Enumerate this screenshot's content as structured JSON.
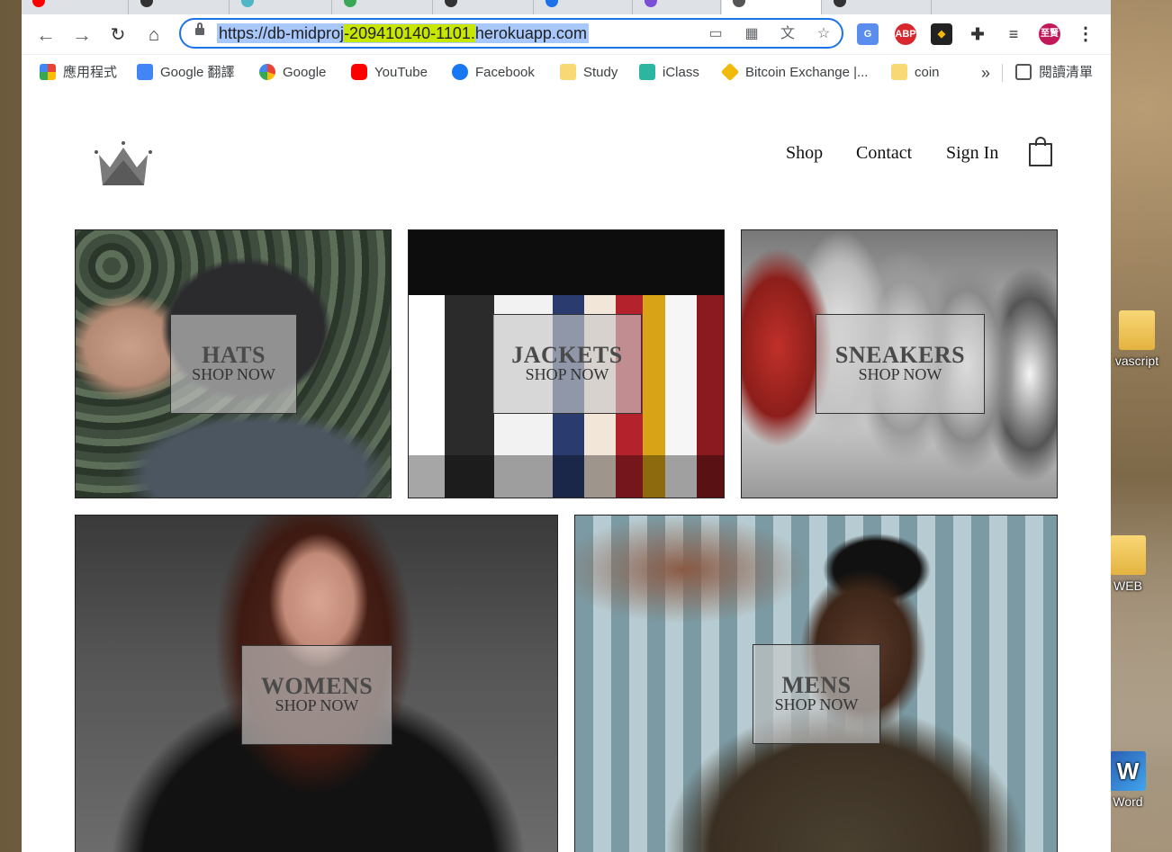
{
  "browser": {
    "url_prefix": "https://db-midproj",
    "url_highlight": "-209410140-1101.",
    "url_suffix": "herokuapp.com",
    "bookmarks": [
      "應用程式",
      "Google 翻譯",
      "Google",
      "YouTube",
      "Facebook",
      "Study",
      "iClass",
      "Bitcoin Exchange |...",
      "coin"
    ],
    "reading_list": "閱讀清單",
    "overflow": "»",
    "profile": "至賢",
    "ext_abp": "ABP"
  },
  "site": {
    "nav": {
      "shop": "Shop",
      "contact": "Contact",
      "signin": "Sign In"
    },
    "tiles": [
      {
        "title": "HATS",
        "subtitle": "SHOP NOW"
      },
      {
        "title": "JACKETS",
        "subtitle": "SHOP NOW"
      },
      {
        "title": "SNEAKERS",
        "subtitle": "SHOP NOW"
      },
      {
        "title": "WOMENS",
        "subtitle": "SHOP NOW"
      },
      {
        "title": "MENS",
        "subtitle": "SHOP NOW"
      }
    ]
  },
  "desktop": {
    "icons": [
      "vascript",
      "WEB",
      "Word"
    ]
  },
  "colors": {
    "accent": "#1a73e8",
    "url_highlight": "#c8e600",
    "selection": "#a8c7fa"
  }
}
